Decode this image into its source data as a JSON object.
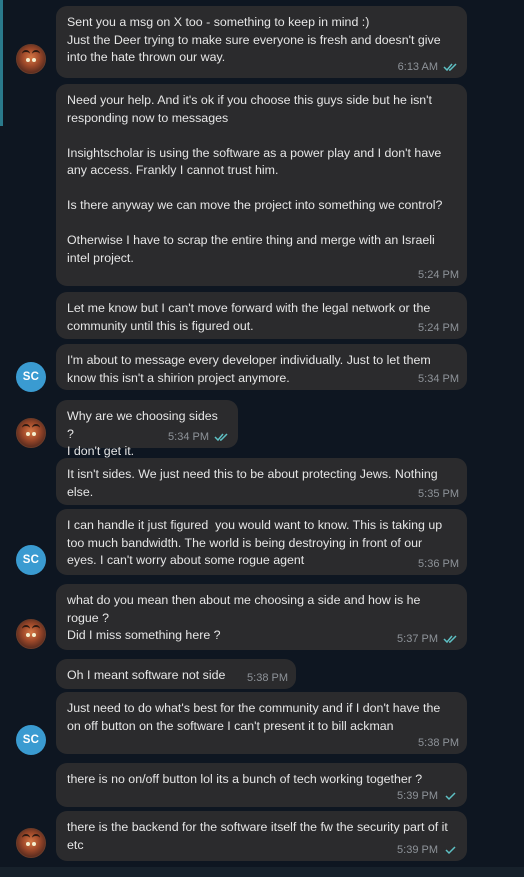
{
  "messages": [
    {
      "text": "Sent you a msg on X too - something to keep in mind :)\nJust the Deer trying to make sure everyone is fresh and doesn't give into the hate thrown our way.",
      "time": "6:13 AM",
      "status": "read"
    },
    {
      "text": "Need your help. And it's ok if you choose this guys side but he isn't responding now to messages\n\nInsightscholar is using the software as a power play and I don't have any access. Frankly I cannot trust him.\n\nIs there anyway we can move the project into something we control?\n\nOtherwise I have to scrap the entire thing and merge with an Israeli intel project.",
      "time": "5:24 PM"
    },
    {
      "text": "Let me know but I can't move forward with the legal network or the community until this is figured out.",
      "time": "5:24 PM"
    },
    {
      "text": "I'm about to message every developer individually. Just to let them know this isn't a shirion project anymore.",
      "time": "5:34 PM"
    },
    {
      "text": "Why are we choosing sides ?\nI don't get it.",
      "time": "5:34 PM",
      "status": "read"
    },
    {
      "text": "It isn't sides. We just need this to be about protecting Jews. Nothing else.",
      "time": "5:35 PM"
    },
    {
      "text": "I can handle it just figured  you would want to know. This is taking up too much bandwidth. The world is being destroying in front of our eyes. I can't worry about some rogue agent",
      "time": "5:36 PM"
    },
    {
      "text": "what do you mean then about me choosing a side and how is he rogue ?\nDid I miss something here ?",
      "time": "5:37 PM",
      "status": "read"
    },
    {
      "text": "Oh I meant software not side",
      "time": "5:38 PM"
    },
    {
      "text": "Just need to do what's best for the community and if I don't have the on off button on the software I can't present it to bill ackman",
      "time": "5:38 PM"
    },
    {
      "text": "there is no on/off button lol its a bunch of tech working together ?",
      "time": "5:39 PM",
      "status": "sent"
    },
    {
      "text": "there is the backend for the software itself the fw the security part of it etc",
      "time": "5:39 PM",
      "status": "sent"
    }
  ],
  "avatars": {
    "deer": {
      "icon": "deer-avatar-icon"
    },
    "sc": {
      "initials": "SC",
      "color": "#3a9bd1"
    }
  },
  "colors": {
    "background": "#0e1621",
    "bubble": "#2b2b2d",
    "meta": "#8e9399",
    "check": "#5ec0c4"
  }
}
